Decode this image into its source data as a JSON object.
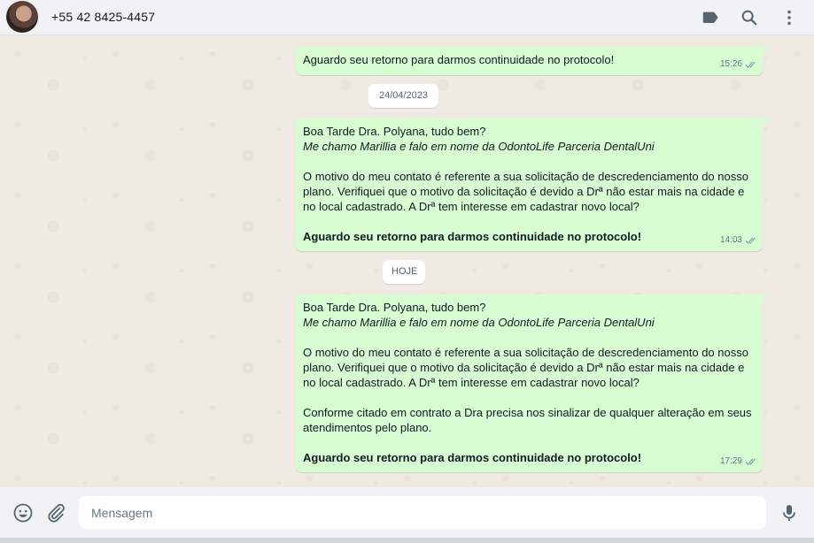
{
  "header": {
    "contact_name": "+55 42 8425-4457",
    "icons": [
      "label-icon",
      "search-icon",
      "menu-icon"
    ]
  },
  "colors": {
    "outgoing_bubble": "#d9fdd3",
    "chat_background": "#efeae2",
    "panel_background": "#f0f2f5",
    "read_ticks": "#8696a0"
  },
  "chat": {
    "messages": [
      {
        "lines": [
          "Aguardo seu retorno para darmos continuidade no protocolo!"
        ],
        "time": "15:26"
      },
      {
        "lines": [
          "Boa Tarde Dra. Polyana, tudo bem?",
          "Me chamo Marillia e falo em nome da OdontoLife Parceria DentalUni",
          "O motivo do meu contato é referente a sua solicitação de descredenciamento do nosso plano. Verifiquei que o motivo da solicitação é devido a Drª não estar mais na cidade e no local cadastrado. A Drª tem interesse em cadastrar novo local?",
          "Aguardo seu retorno para darmos continuidade no protocolo!"
        ],
        "time": "14:03"
      },
      {
        "lines": [
          "Boa Tarde Dra. Polyana, tudo bem?",
          "Me chamo Marillia e falo em nome da OdontoLife Parceria DentalUni",
          "O motivo do meu contato é referente a sua solicitação de descredenciamento do nosso plano. Verifiquei que o motivo da solicitação é devido a Drª não estar mais na cidade e no local cadastrado. A Drª tem interesse em cadastrar novo local?",
          "Conforme citado em contrato a Dra precisa nos sinalizar de qualquer alteração em seus atendimentos pelo plano.",
          "Aguardo seu retorno para darmos continuidade no protocolo!"
        ],
        "time": "17:29"
      }
    ],
    "date_separators": [
      "24/04/2023",
      "HOJE"
    ]
  },
  "footer": {
    "placeholder": "Mensagem",
    "value": "",
    "icons": [
      "emoji-icon",
      "attach-icon",
      "microphone-icon"
    ]
  }
}
